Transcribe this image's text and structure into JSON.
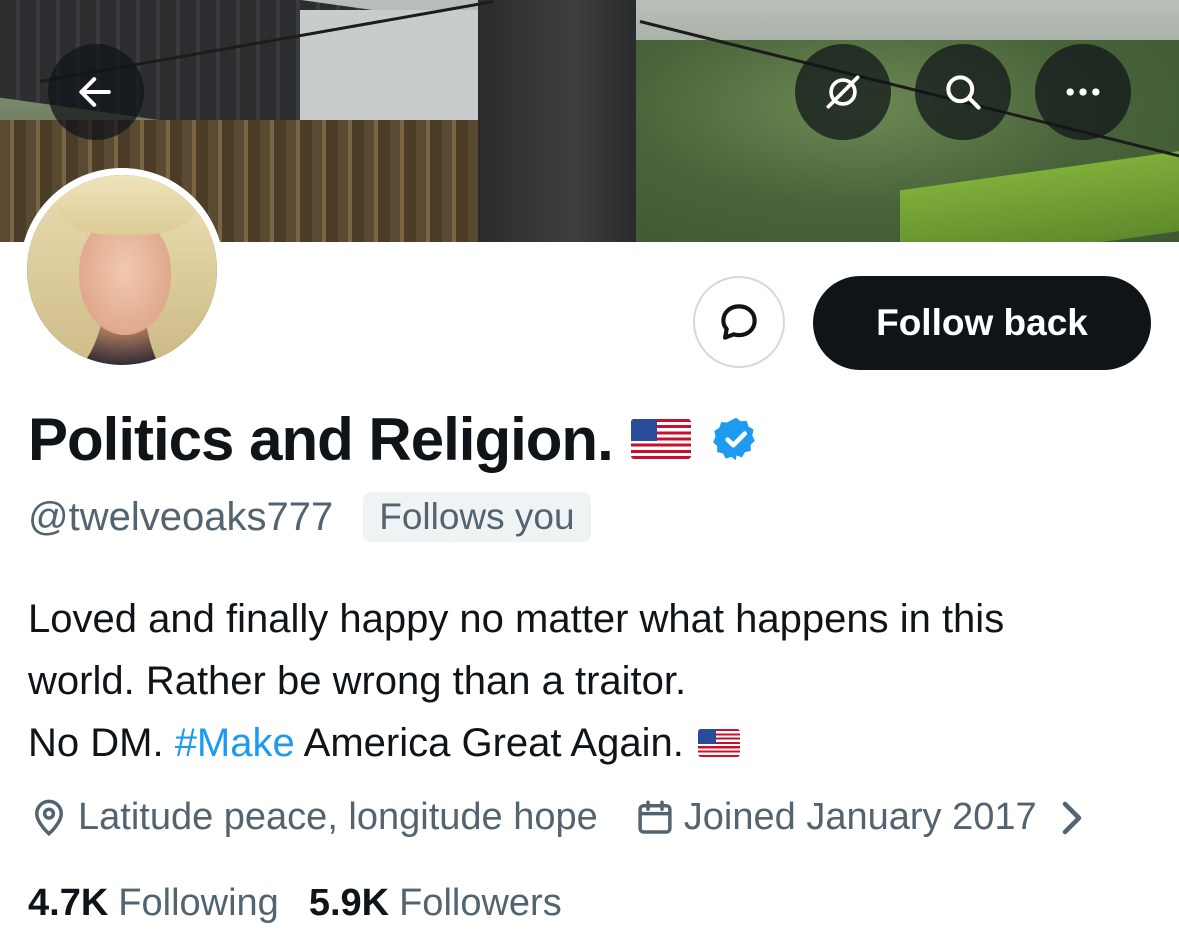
{
  "header": {
    "back_icon": "arrow-left-icon",
    "grok_icon": "slashed-circle-icon",
    "search_icon": "search-icon",
    "more_icon": "more-horizontal-icon"
  },
  "profile": {
    "display_name": "Politics and Religion.",
    "handle": "@twelveoaks777",
    "follows_you": "Follows you",
    "bio_line1": "Loved and finally happy no matter what happens in this",
    "bio_line2": "world. Rather be wrong than a traitor.",
    "bio_line3_prefix": "No DM. ",
    "bio_hashtag": "#Make",
    "bio_line3_suffix": " America Great Again.",
    "location": "Latitude peace, longitude hope",
    "joined": "Joined January 2017",
    "following_count": "4.7K",
    "following_label": "Following",
    "followers_count": "5.9K",
    "followers_label": "Followers"
  },
  "actions": {
    "follow_back_label": "Follow back",
    "message_icon": "message-bubble-icon"
  },
  "colors": {
    "text": "#0f1419",
    "secondary": "#536471",
    "link": "#1d9bf0",
    "button_dark": "#0f1419",
    "verified": "#1d9bf0"
  }
}
